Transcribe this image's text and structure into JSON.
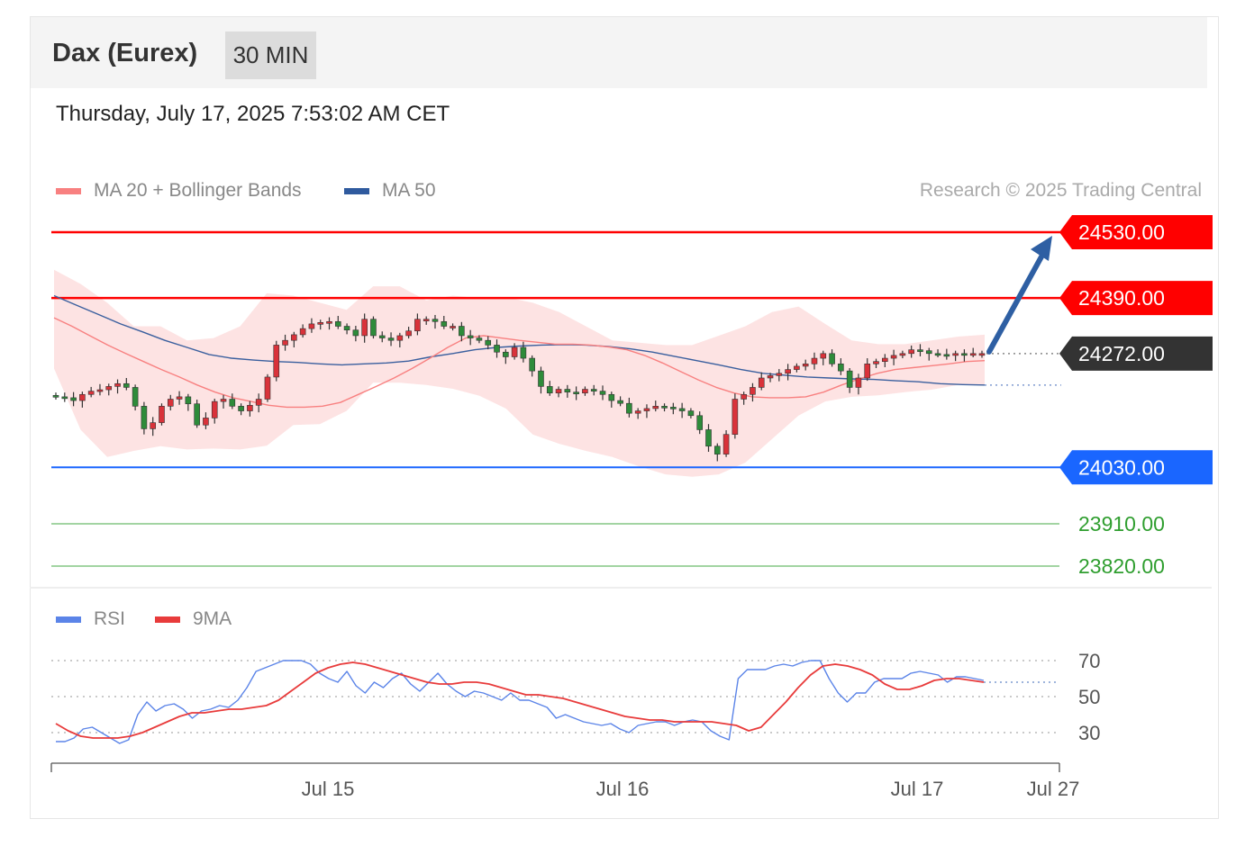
{
  "header": {
    "title": "Dax (Eurex)",
    "timeframe": "30 MIN"
  },
  "datetime": "Thursday, July 17, 2025 7:53:02 AM CET",
  "legend": {
    "ma20_label": "MA 20 + Bollinger Bands",
    "ma50_label": "MA 50",
    "credit": "Research © 2025 Trading Central"
  },
  "rsi_legend": {
    "rsi_label": "RSI",
    "ma9_label": "9MA"
  },
  "colors": {
    "resistance": "#ff0000",
    "support": "#1a66ff",
    "target": "#2f9e2f",
    "bollinger_fill": "#fde0e0",
    "ma20": "#f88080",
    "ma50": "#3a5f9e",
    "candle_up": "#d9323a",
    "candle_down": "#2e8b3a",
    "arrow": "#2e5fa3",
    "current_badge": "#333333",
    "rsi": "#5b84e8",
    "rsi_ma": "#e83b3b"
  },
  "chart_data": [
    {
      "type": "candlestick",
      "title": "Dax (Eurex)",
      "y_range": [
        23780,
        24590
      ],
      "levels": {
        "resistance": [
          {
            "label": "24530.00",
            "value": 24530
          },
          {
            "label": "24390.00",
            "value": 24390
          }
        ],
        "current": {
          "label": "24272.00",
          "value": 24272
        },
        "support": [
          {
            "label": "24030.00",
            "value": 24030
          }
        ],
        "targets": [
          {
            "label": "23910.00",
            "value": 23910
          },
          {
            "label": "23820.00",
            "value": 23820
          }
        ]
      },
      "ma50_endpoint": 24205,
      "arrow": {
        "from": 24272,
        "to": 24530,
        "direction": "up"
      },
      "x_labels": [
        "Jul 15",
        "Jul 16",
        "Jul 17",
        "Jul 27"
      ],
      "candles_close": [
        24180,
        24178,
        24172,
        24185,
        24192,
        24195,
        24202,
        24208,
        24200,
        24160,
        24112,
        24125,
        24160,
        24175,
        24180,
        24165,
        24120,
        24135,
        24170,
        24175,
        24160,
        24150,
        24162,
        24175,
        24222,
        24290,
        24300,
        24312,
        24325,
        24335,
        24338,
        24340,
        24330,
        24322,
        24310,
        24345,
        24310,
        24305,
        24300,
        24310,
        24320,
        24345,
        24345,
        24340,
        24330,
        24330,
        24310,
        24305,
        24300,
        24290,
        24275,
        24265,
        24285,
        24262,
        24235,
        24202,
        24188,
        24196,
        24190,
        24188,
        24196,
        24192,
        24185,
        24172,
        24166,
        24145,
        24150,
        24155,
        24160,
        24158,
        24155,
        24150,
        24140,
        24110,
        24075,
        24058,
        24100,
        24175,
        24185,
        24200,
        24220,
        24225,
        24230,
        24238,
        24245,
        24250,
        24262,
        24272,
        24250,
        24235,
        24200,
        24220,
        24250,
        24255,
        24262,
        24268,
        24272,
        24280,
        24278,
        24272,
        24270,
        24268,
        24272,
        24270,
        24272,
        24272
      ],
      "ma20": [
        24348,
        24330,
        24310,
        24290,
        24272,
        24255,
        24238,
        24222,
        24205,
        24190,
        24178,
        24170,
        24162,
        24158,
        24158,
        24160,
        24168,
        24185,
        24202,
        24220,
        24240,
        24262,
        24285,
        24305,
        24310,
        24305,
        24300,
        24296,
        24292,
        24292,
        24290,
        24286,
        24280,
        24268,
        24252,
        24234,
        24216,
        24200,
        24188,
        24180,
        24178,
        24178,
        24180,
        24190,
        24205,
        24218,
        24230,
        24238,
        24242,
        24246,
        24250,
        24255,
        24257
      ],
      "ma50": [
        24395,
        24375,
        24355,
        24335,
        24318,
        24300,
        24285,
        24270,
        24262,
        24258,
        24255,
        24253,
        24250,
        24248,
        24250,
        24252,
        24256,
        24265,
        24272,
        24280,
        24285,
        24288,
        24290,
        24291,
        24290,
        24287,
        24282,
        24275,
        24266,
        24257,
        24248,
        24238,
        24230,
        24226,
        24222,
        24220,
        24218,
        24217,
        24214,
        24212,
        24208,
        24206,
        24205
      ],
      "bb_upper": [
        24450,
        24420,
        24380,
        24330,
        24330,
        24300,
        24305,
        24330,
        24400,
        24395,
        24380,
        24365,
        24415,
        24415,
        24385,
        24395,
        24390,
        24392,
        24380,
        24360,
        24330,
        24300,
        24295,
        24290,
        24290,
        24310,
        24330,
        24360,
        24372,
        24335,
        24300,
        24292,
        24292,
        24300,
        24308,
        24312
      ],
      "bb_lower": [
        24240,
        24110,
        24052,
        24065,
        24075,
        24068,
        24070,
        24068,
        24076,
        24120,
        24122,
        24150,
        24210,
        24210,
        24205,
        24197,
        24182,
        24155,
        24100,
        24080,
        24065,
        24052,
        24032,
        24015,
        24010,
        24015,
        24040,
        24090,
        24140,
        24170,
        24180,
        24183,
        24190,
        24195,
        24205,
        24205
      ]
    },
    {
      "type": "line",
      "title": "RSI",
      "y_range": [
        22,
        78
      ],
      "reference_levels": [
        70,
        50,
        30
      ],
      "series": [
        {
          "name": "RSI",
          "values": [
            25,
            25,
            27,
            32,
            33,
            30,
            27,
            24,
            26,
            40,
            47,
            42,
            45,
            46,
            43,
            38,
            42,
            43,
            45,
            44,
            48,
            55,
            64,
            66,
            68,
            70,
            70,
            70,
            68,
            63,
            60,
            58,
            64,
            56,
            52,
            58,
            55,
            60,
            63,
            57,
            53,
            58,
            63,
            57,
            53,
            50,
            53,
            52,
            50,
            48,
            52,
            48,
            48,
            46,
            44,
            38,
            40,
            38,
            36,
            35,
            34,
            35,
            32,
            30,
            34,
            35,
            36,
            36,
            34,
            36,
            37,
            36,
            31,
            28,
            26,
            60,
            65,
            65,
            65,
            67,
            68,
            67,
            69,
            70,
            70,
            60,
            52,
            47,
            52,
            52,
            58,
            60,
            60,
            60,
            63,
            64,
            63,
            62,
            58,
            61,
            61,
            60,
            59
          ]
        },
        {
          "name": "9MA",
          "values": [
            35,
            31,
            28,
            27,
            27,
            27,
            28,
            30,
            33,
            36,
            39,
            41,
            41,
            42,
            43,
            43,
            44,
            45,
            48,
            53,
            58,
            63,
            66,
            68,
            69,
            68,
            66,
            64,
            62,
            60,
            58,
            57,
            57,
            58,
            58,
            57,
            55,
            53,
            51,
            51,
            50,
            49,
            47,
            45,
            43,
            41,
            39,
            38,
            37,
            37,
            36,
            36,
            36,
            36,
            35,
            34,
            31,
            33,
            40,
            47,
            55,
            62,
            67,
            68,
            67,
            65,
            62,
            57,
            54,
            54,
            56,
            59,
            60,
            60,
            59,
            58
          ]
        }
      ]
    }
  ]
}
